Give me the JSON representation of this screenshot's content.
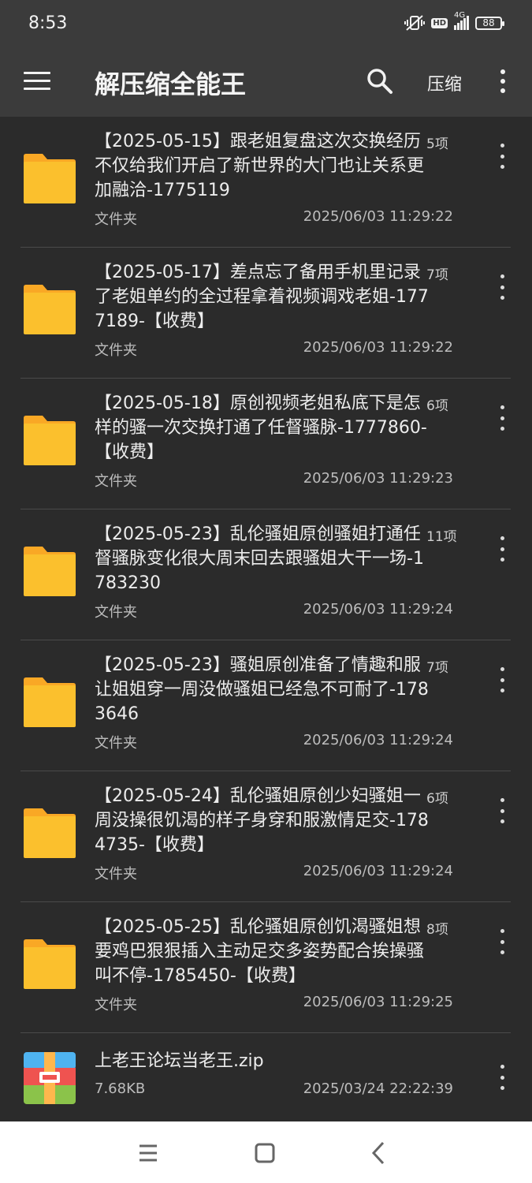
{
  "status_bar": {
    "time": "8:53",
    "hd": "HD",
    "network": "4G",
    "battery": "88"
  },
  "app_bar": {
    "title": "解压缩全能王",
    "compress_label": "压缩",
    "icons": [
      "menu-icon",
      "search-icon",
      "more-vert-icon"
    ]
  },
  "files": [
    {
      "name": "【2025-05-15】跟老姐复盘这次交换经历不仅给我们开启了新世界的大门也让关系更加融洽-1775119",
      "count": "5项",
      "type": "文件夹",
      "date": "2025/06/03 11:29:22"
    },
    {
      "name": "【2025-05-17】差点忘了备用手机里记录了老姐单约的全过程拿着视频调戏老姐-1777189-【收费】",
      "count": "7项",
      "type": "文件夹",
      "date": "2025/06/03 11:29:22"
    },
    {
      "name": "【2025-05-18】原创视频老姐私底下是怎样的骚一次交换打通了任督骚脉-1777860-【收费】",
      "count": "6项",
      "type": "文件夹",
      "date": "2025/06/03 11:29:23"
    },
    {
      "name": "【2025-05-23】乱伦骚姐原创骚姐打通任督骚脉变化很大周末回去跟骚姐大干一场-1783230",
      "count": "11项",
      "type": "文件夹",
      "date": "2025/06/03 11:29:24"
    },
    {
      "name": "【2025-05-23】骚姐原创准备了情趣和服让姐姐穿一周没做骚姐已经急不可耐了-1783646",
      "count": "7项",
      "type": "文件夹",
      "date": "2025/06/03 11:29:24"
    },
    {
      "name": "【2025-05-24】乱伦骚姐原创少妇骚姐一周没操很饥渴的样子身穿和服激情足交-1784735-【收费】",
      "count": "6项",
      "type": "文件夹",
      "date": "2025/06/03 11:29:24"
    },
    {
      "name": "【2025-05-25】乱伦骚姐原创饥渴骚姐想要鸡巴狠狠插入主动足交多姿势配合挨操骚叫不停-1785450-【收费】",
      "count": "8项",
      "type": "文件夹",
      "date": "2025/06/03 11:29:25"
    }
  ],
  "zip_file": {
    "name": "上老王论坛当老王.zip",
    "size": "7.68KB",
    "date": "2025/03/24 22:22:39"
  },
  "navbar": {
    "icons": [
      "recents-icon",
      "home-icon",
      "back-icon"
    ]
  },
  "colors": {
    "background": "#2b2b2b",
    "app_bar": "#3b3b3b",
    "folder": "#fbc02d",
    "folder_tab": "#f9a825"
  }
}
